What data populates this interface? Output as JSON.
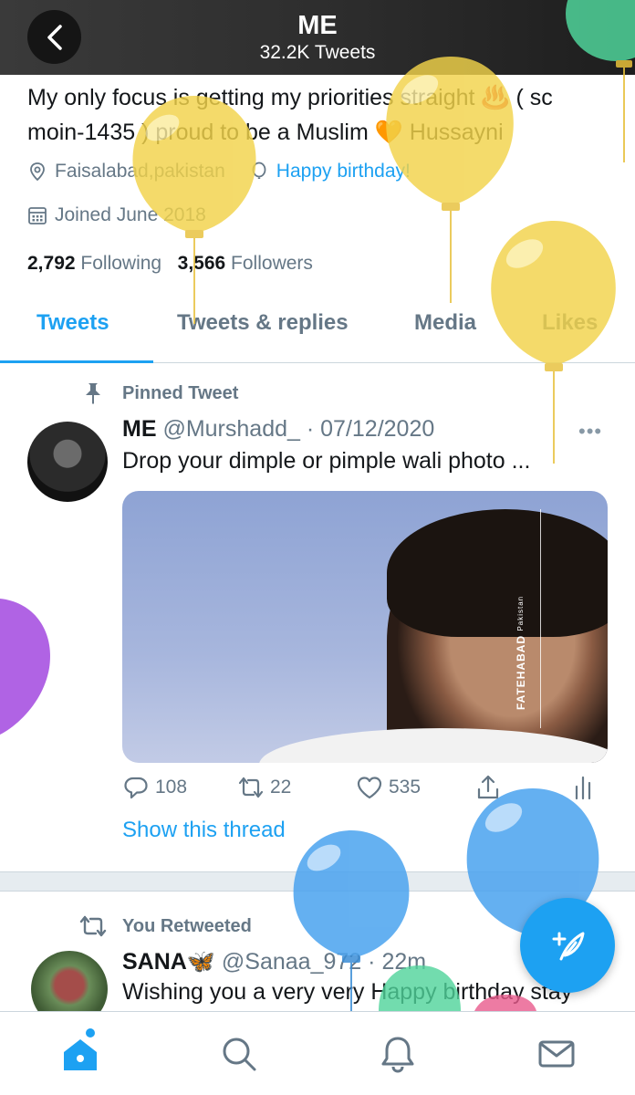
{
  "header": {
    "title": "ME",
    "subtitle": "32.2K Tweets"
  },
  "profile": {
    "bio_line1": "My only focus is getting my priorities straight ♨️ ( sc",
    "bio_line2": "moin-1435 ) proud to be a Muslim 🧡 Hussayni",
    "location": "Faisalabad,pakistan",
    "birthday": "Happy birthday!",
    "joined": "Joined June 2018",
    "following_count": "2,792",
    "following_label": "Following",
    "followers_count": "3,566",
    "followers_label": "Followers"
  },
  "tabs": [
    "Tweets",
    "Tweets & replies",
    "Media",
    "Likes"
  ],
  "pinned_tweet": {
    "pinned_label": "Pinned Tweet",
    "name": "ME",
    "handle": "@Murshadd_",
    "date": "· 07/12/2020",
    "text": "Drop your dimple or pimple wali photo ...",
    "watermark": "FATEHABAD",
    "watermark_sub": "Pakistan",
    "replies": "108",
    "retweets": "22",
    "likes": "535",
    "show_thread": "Show this thread"
  },
  "retweet": {
    "retweeted_label": "You Retweeted",
    "name": "SANA🦋",
    "handle": "@Sanaa_972",
    "time": "· 22m",
    "text": "Wishing you a very very Happy birthday stay"
  },
  "colors": {
    "accent": "#1da1f2",
    "secondary_text": "#657786",
    "balloon_yellow": "#f2d34a",
    "balloon_blue": "#4aa3ef",
    "balloon_purple": "#a54de0",
    "balloon_green": "#4fd39a"
  },
  "icons": {
    "back": "chevron-left-icon",
    "location": "location-pin-icon",
    "birthday": "balloon-icon",
    "calendar": "calendar-icon",
    "pin": "pin-icon",
    "reply": "reply-icon",
    "retweet": "retweet-icon",
    "like": "heart-icon",
    "share": "share-icon",
    "analytics": "analytics-icon",
    "home": "home-icon",
    "search": "search-icon",
    "notifications": "bell-icon",
    "messages": "mail-icon",
    "compose": "compose-icon"
  }
}
